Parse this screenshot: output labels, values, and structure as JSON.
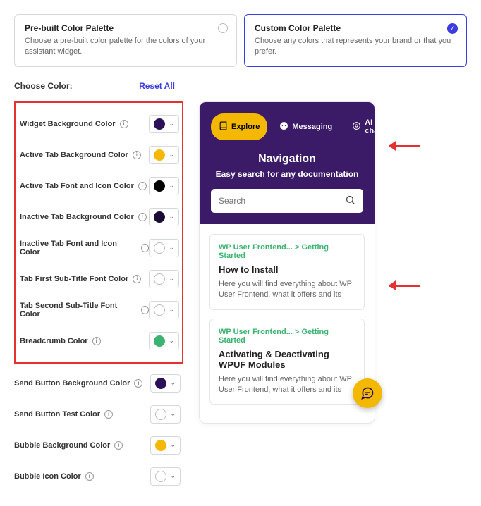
{
  "topCards": [
    {
      "title": "Pre-built Color Palette",
      "desc": "Choose a pre-built color palette for the colors of your assistant widget.",
      "selected": false
    },
    {
      "title": "Custom Color Palette",
      "desc": "Choose any colors that represents your brand or that you prefer.",
      "selected": true
    }
  ],
  "chooseLabel": "Choose Color:",
  "resetAll": "Reset All",
  "colorsHighlight": [
    {
      "label": "Widget Background Color",
      "color": "#2b1258"
    },
    {
      "label": "Active Tab Background Color",
      "color": "#f5b800"
    },
    {
      "label": "Active Tab Font and Icon Color",
      "color": "#000000"
    },
    {
      "label": "Inactive Tab Background Color",
      "color": "#1a0c35"
    },
    {
      "label": "Inactive Tab Font and Icon Color",
      "color": "#ffffff",
      "outlined": true
    },
    {
      "label": "Tab First Sub-Title Font Color",
      "color": "#ffffff",
      "outlined": true
    },
    {
      "label": "Tab Second Sub-Title Font Color",
      "color": "#ffffff",
      "outlined": true
    },
    {
      "label": "Breadcrumb Color",
      "color": "#3cb371"
    }
  ],
  "colorsBelow": [
    {
      "label": "Send Button Background Color",
      "color": "#2b1258"
    },
    {
      "label": "Send Button Test Color",
      "color": "#ffffff",
      "outlined": true
    },
    {
      "label": "Bubble Background Color",
      "color": "#f5b800"
    },
    {
      "label": "Bubble Icon Color",
      "color": "#ffffff",
      "outlined": true
    }
  ],
  "preview": {
    "tabs": [
      {
        "label": "Explore",
        "active": true
      },
      {
        "label": "Messaging",
        "active": false
      },
      {
        "label": "AI chat",
        "active": false
      }
    ],
    "title": "Navigation",
    "subtitle": "Easy search for any documentation",
    "searchPlaceholder": "Search",
    "results": [
      {
        "breadcrumb": "WP User Frontend... > Getting Started",
        "title": "How to Install",
        "desc": "Here you will find everything about WP User Frontend, what it offers and its"
      },
      {
        "breadcrumb": "WP User Frontend... > Getting Started",
        "title": "Activating & Deactivating WPUF Modules",
        "desc": "Here you will find everything about WP User Frontend, what it offers and its"
      }
    ]
  }
}
